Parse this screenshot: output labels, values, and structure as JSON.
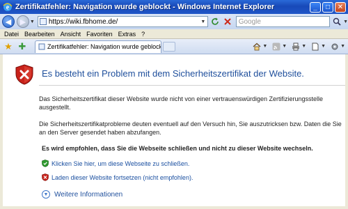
{
  "window": {
    "title": "Zertifikatfehler: Navigation wurde geblockt - Windows Internet Explorer",
    "minimize": "_",
    "maximize": "□",
    "close": "✕"
  },
  "address_bar": {
    "url": "https://wiki.fbhome.de/",
    "search_placeholder": "Google"
  },
  "menu": {
    "items": [
      "Datei",
      "Bearbeiten",
      "Ansicht",
      "Favoriten",
      "Extras",
      "?"
    ]
  },
  "tab": {
    "label": "Zertifikatfehler: Navigation wurde geblockt"
  },
  "icons": {
    "back": "back-arrow-icon",
    "forward": "forward-arrow-icon",
    "refresh": "refresh-icon",
    "stop": "stop-icon",
    "search": "magnifier-icon",
    "favorites": "star-icon",
    "home": "home-icon",
    "feeds": "feed-icon",
    "print": "printer-icon",
    "page": "page-icon",
    "tools": "gear-icon",
    "shield": "red-shield-x-icon"
  },
  "content": {
    "heading": "Es besteht ein Problem mit dem Sicherheitszertifikat der Website.",
    "paragraph1": "Das Sicherheitszertifikat dieser Website wurde nicht von einer vertrauenswürdigen Zertifizierungsstelle ausgestellt.",
    "paragraph2": "Die Sicherheitszertifikatprobleme deuten eventuell auf den Versuch hin, Sie auszutricksen bzw. Daten die Sie an den Server gesendet haben abzufangen.",
    "recommendation": "Es wird empfohlen, dass Sie die Webseite schließen und nicht zu dieser Website wechseln.",
    "link_close": "Klicken Sie hier, um diese Webseite zu schließen.",
    "link_continue": "Laden dieser Website fortsetzen (nicht empfohlen).",
    "more_info": "Weitere Informationen"
  },
  "colors": {
    "heading": "#1f4f9c",
    "link": "#1a4fa0",
    "titlebar": "#1f56c8"
  }
}
